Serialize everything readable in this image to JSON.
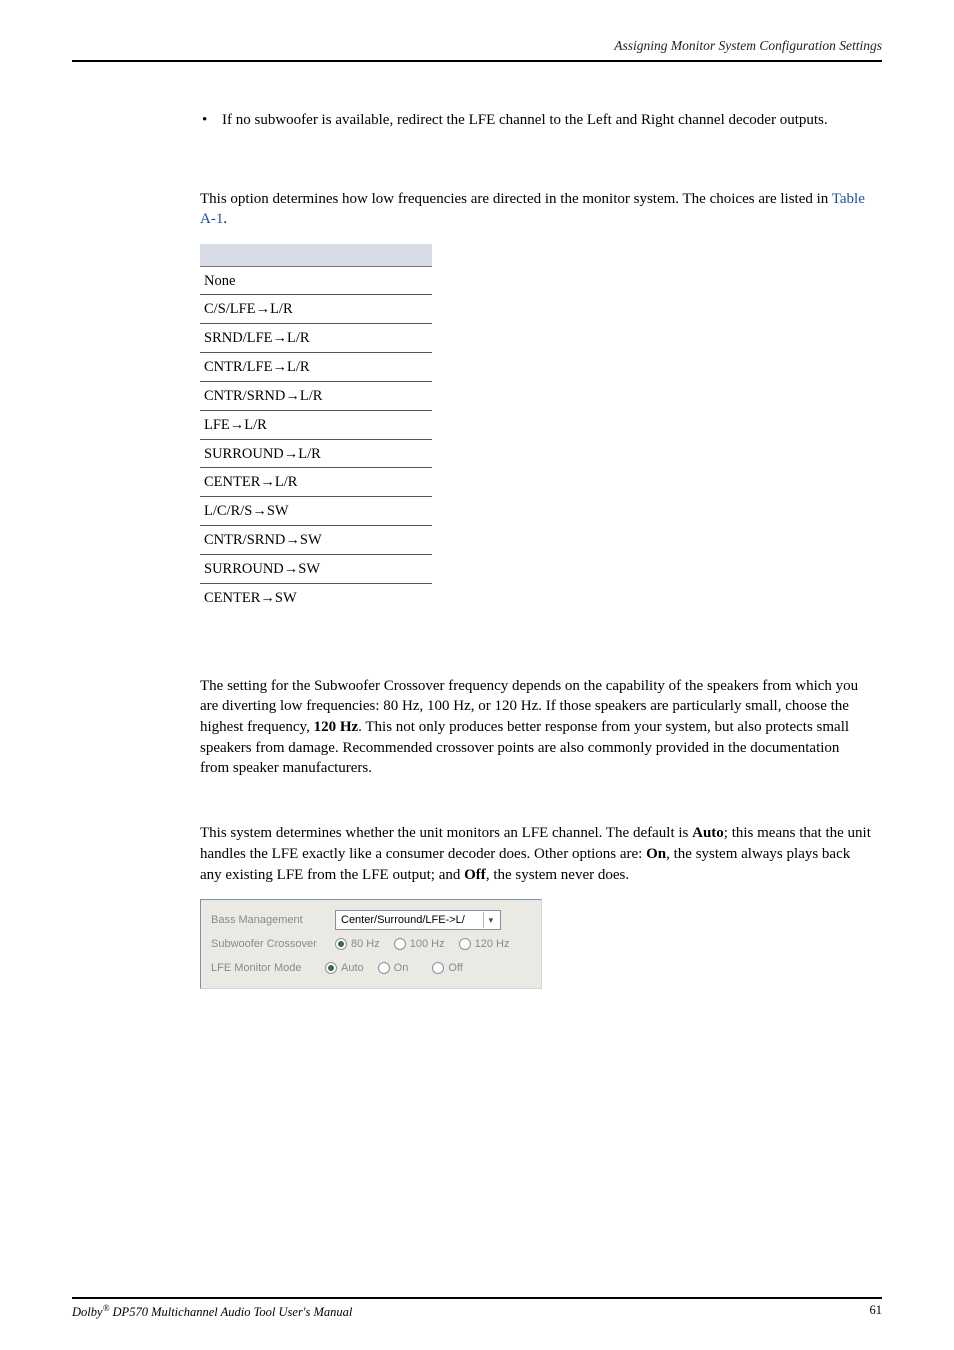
{
  "header": {
    "running": "Assigning Monitor System Configuration Settings"
  },
  "bullet": {
    "item": "If no subwoofer is available, redirect the LFE channel to the Left and Right channel decoder outputs."
  },
  "bass_intro": {
    "p1a": "This option determines how low frequencies are directed in the monitor system. The choices are listed in ",
    "link": "Table A-1",
    "p1b": "."
  },
  "table": {
    "rows": [
      "None",
      "C/S/LFE→L/R",
      "SRND/LFE→L/R",
      "CNTR/LFE→L/R",
      "CNTR/SRND→L/R",
      "LFE→L/R",
      "SURROUND→L/R",
      "CENTER→L/R",
      "L/C/R/S→SW",
      "CNTR/SRND→SW",
      "SURROUND→SW",
      "CENTER→SW"
    ]
  },
  "crossover": {
    "p_a": "The setting for the Subwoofer Crossover frequency depends on the capability of the speakers from which you are diverting low frequencies: 80 Hz, 100 Hz, or 120 Hz. If those speakers are particularly small, choose the highest frequency, ",
    "p_bold": "120 Hz",
    "p_b": ". This not only produces better response from your system, but also protects small speakers from damage. Recommended crossover points are also commonly provided in the documentation from speaker manufacturers."
  },
  "lfe": {
    "p_a": "This system determines whether the unit monitors an LFE channel. The default is ",
    "b1": "Auto",
    "p_b": "; this means that the unit handles the LFE exactly like a consumer decoder does. Other options are: ",
    "b2": "On",
    "p_c": ", the system always plays back any existing LFE from the LFE output; and ",
    "b3": "Off",
    "p_d": ", the system never does."
  },
  "panel": {
    "row1_label": "Bass Management",
    "row1_value": "Center/Surround/LFE->L/",
    "row2_label": "Subwoofer Crossover",
    "row2_opts": [
      "80 Hz",
      "100 Hz",
      "120 Hz"
    ],
    "row3_label": "LFE Monitor Mode",
    "row3_opts": [
      "Auto",
      "On",
      "Off"
    ]
  },
  "footer": {
    "left_a": "Dolby",
    "left_b": " DP570 Multichannel Audio Tool User's Manual",
    "page": "61"
  }
}
